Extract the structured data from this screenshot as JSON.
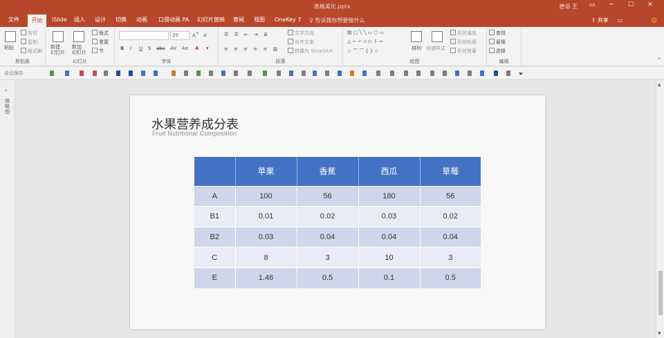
{
  "window": {
    "title": "表格美化.pptx",
    "user": "德语 王"
  },
  "tabs": [
    "文件",
    "开始",
    "iSlide",
    "插入",
    "设计",
    "切换",
    "动画",
    "口袋动画 PA",
    "幻灯片放映",
    "审阅",
    "视图",
    "OneKey 7"
  ],
  "tell_me": "告诉我你想要做什么",
  "share_label": "共享",
  "ribbon": {
    "clipboard": {
      "paste": "粘贴",
      "cut": "剪切",
      "copy": "复制",
      "format_painter": "格式刷",
      "label": "剪贴板"
    },
    "slides": {
      "new_slide": "新建\n幻灯片",
      "reuse": "新加\n幻灯片",
      "layout": "版式",
      "reset": "重置",
      "section": "节",
      "label": "幻灯片"
    },
    "font": {
      "name": "",
      "size": "20",
      "label": "字体",
      "bold": "B",
      "italic": "I",
      "underline": "U",
      "shadow": "S",
      "strike": "abc",
      "spacing": "AV",
      "case": "Aa"
    },
    "paragraph": {
      "text_direction": "文字方向",
      "align_text": "对齐文本",
      "smartart": "转换为 SmartArt",
      "label": "段落"
    },
    "drawing": {
      "arrange": "排列",
      "quick_styles": "快速样式",
      "fill": "形状填充",
      "outline": "形状轮廓",
      "effects": "形状效果",
      "label": "绘图"
    },
    "editing": {
      "find": "查找",
      "replace": "替换",
      "select": "选择",
      "label": "编辑"
    }
  },
  "qat_label": "自动保存",
  "left_panel": {
    "label": "缩略图"
  },
  "slide": {
    "title": "水果营养成分表",
    "subtitle": "Fruit Nutritional Composition",
    "table": {
      "headers": [
        "",
        "苹果",
        "香蕉",
        "西瓜",
        "草莓"
      ],
      "rows": [
        [
          "A",
          "100",
          "56",
          "180",
          "56"
        ],
        [
          "B1",
          "0.01",
          "0.02",
          "0.03",
          "0.02"
        ],
        [
          "B2",
          "0.03",
          "0.04",
          "0.04",
          "0.04"
        ],
        [
          "C",
          "8",
          "3",
          "10",
          "3"
        ],
        [
          "E",
          "1.46",
          "0.5",
          "0.1",
          "0.5"
        ]
      ]
    }
  },
  "colors": {
    "accent": "#b7472a",
    "table_header": "#4472c4",
    "row_odd": "#cfd5ea",
    "row_even": "#e9ebf5"
  }
}
